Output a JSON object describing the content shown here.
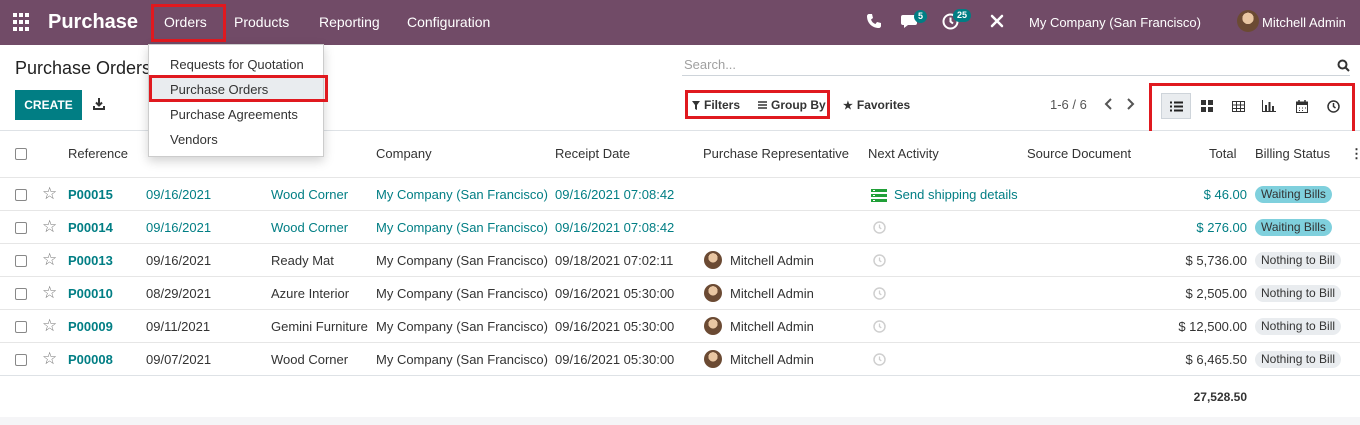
{
  "navbar": {
    "app_name": "Purchase",
    "menu": [
      "Orders",
      "Products",
      "Reporting",
      "Configuration"
    ],
    "messages_count": "5",
    "activities_count": "25",
    "company": "My Company (San Francisco)",
    "user": "Mitchell Admin"
  },
  "orders_menu": {
    "items": [
      "Requests for Quotation",
      "Purchase Orders",
      "Purchase Agreements",
      "Vendors"
    ],
    "active_index": 1
  },
  "control_panel": {
    "breadcrumb": "Purchase Orders",
    "create_label": "CREATE",
    "search_placeholder": "Search...",
    "filters_label": "Filters",
    "group_by_label": "Group By",
    "favorites_label": "Favorites",
    "pager": "1-6 / 6",
    "views": [
      "list",
      "kanban",
      "pivot",
      "graph",
      "calendar",
      "activity"
    ]
  },
  "table": {
    "columns": [
      "Reference",
      "Company",
      "Receipt Date",
      "Purchase Representative",
      "Next Activity",
      "Source Document",
      "Total",
      "Billing Status"
    ],
    "rows": [
      {
        "reference": "P00015",
        "date": "09/16/2021",
        "vendor": "Wood Corner",
        "company": "My Company (San Francisco)",
        "receipt_date": "09/16/2021 07:08:42",
        "representative": "",
        "activity": "Send shipping details",
        "total": "$ 46.00",
        "billing_status": "Waiting Bills",
        "highlight": true
      },
      {
        "reference": "P00014",
        "date": "09/16/2021",
        "vendor": "Wood Corner",
        "company": "My Company (San Francisco)",
        "receipt_date": "09/16/2021 07:08:42",
        "representative": "",
        "activity": "",
        "total": "$ 276.00",
        "billing_status": "Waiting Bills",
        "highlight": true
      },
      {
        "reference": "P00013",
        "date": "09/16/2021",
        "vendor": "Ready Mat",
        "company": "My Company (San Francisco)",
        "receipt_date": "09/18/2021 07:02:11",
        "representative": "Mitchell Admin",
        "activity": "",
        "total": "$ 5,736.00",
        "billing_status": "Nothing to Bill",
        "highlight": false
      },
      {
        "reference": "P00010",
        "date": "08/29/2021",
        "vendor": "Azure Interior",
        "company": "My Company (San Francisco)",
        "receipt_date": "09/16/2021 05:30:00",
        "representative": "Mitchell Admin",
        "activity": "",
        "total": "$ 2,505.00",
        "billing_status": "Nothing to Bill",
        "highlight": false
      },
      {
        "reference": "P00009",
        "date": "09/11/2021",
        "vendor": "Gemini Furniture",
        "company": "My Company (San Francisco)",
        "receipt_date": "09/16/2021 05:30:00",
        "representative": "Mitchell Admin",
        "activity": "",
        "total": "$ 12,500.00",
        "billing_status": "Nothing to Bill",
        "highlight": false
      },
      {
        "reference": "P00008",
        "date": "09/07/2021",
        "vendor": "Wood Corner",
        "company": "My Company (San Francisco)",
        "receipt_date": "09/16/2021 05:30:00",
        "representative": "Mitchell Admin",
        "activity": "",
        "total": "$ 6,465.50",
        "billing_status": "Nothing to Bill",
        "highlight": false
      }
    ],
    "total_sum": "27,528.50"
  },
  "colors": {
    "navbar": "#714b67",
    "primary": "#017e84",
    "highlight_box": "#e0191f",
    "waiting_bills_badge": "#7fd0dd",
    "nothing_to_bill_badge": "#e9ecef"
  }
}
